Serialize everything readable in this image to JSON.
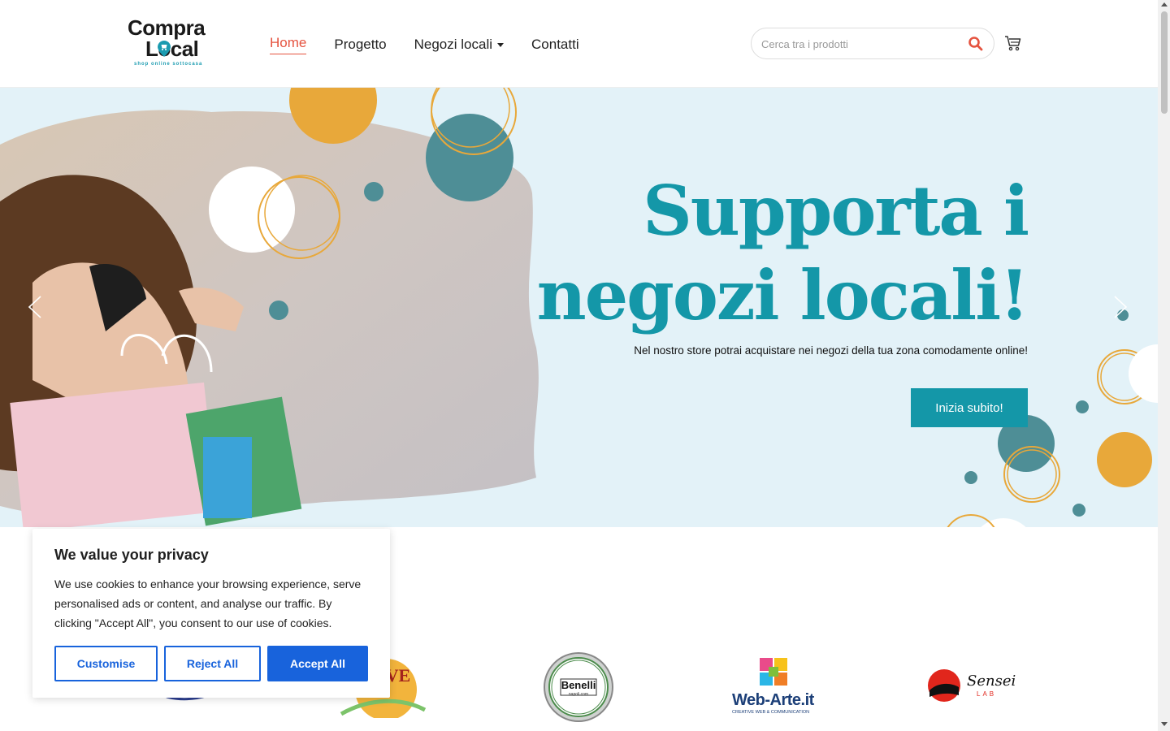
{
  "header": {
    "logo": {
      "line1": "Compra",
      "line2": "Local",
      "tagline": "shop online sottocasa"
    },
    "nav": [
      {
        "label": "Home",
        "active": true
      },
      {
        "label": "Progetto"
      },
      {
        "label": "Negozi locali",
        "dropdown": true
      },
      {
        "label": "Contatti"
      }
    ],
    "search": {
      "placeholder": "Cerca tra i prodotti",
      "value": ""
    },
    "icons": {
      "search": "search-icon",
      "cart": "cart-icon"
    }
  },
  "hero": {
    "title_line1": "Supporta i",
    "title_line2": "negozi locali!",
    "subtitle": "Nel nostro store potrai acquistare nei negozi della tua zona comodamente online!",
    "cta": "Inizia subito!",
    "colors": {
      "accent": "#1497a8",
      "background": "#e3f2f8",
      "dot_teal": "#4e8e96",
      "dot_orange": "#e8a83a"
    }
  },
  "brands": [
    {
      "name": "Benelli",
      "sub": "napoli.com"
    },
    {
      "name": "Web-Arte.it",
      "sub": "CREATIVE WEB & COMMUNICATION"
    },
    {
      "name": "Sensei",
      "sub": "LAB"
    },
    {
      "name": "ERVE"
    }
  ],
  "cookie": {
    "title": "We value your privacy",
    "text": "We use cookies to enhance your browsing experience, serve personalised ads or content, and analyse our traffic. By clicking \"Accept All\", you consent to our use of cookies.",
    "buttons": {
      "customise": "Customise",
      "reject": "Reject All",
      "accept": "Accept All"
    },
    "colors": {
      "primary": "#1863dc"
    }
  }
}
